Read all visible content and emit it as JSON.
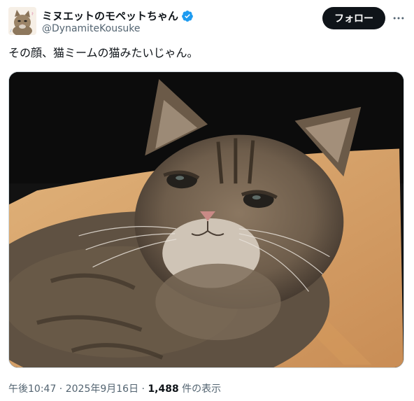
{
  "author": {
    "display_name": "ミヌエットのモペットちゃん",
    "handle": "@DynamiteKousuke",
    "verified": true,
    "avatar": "cat-avatar"
  },
  "actions": {
    "follow_label": "フォロー",
    "more_icon": "more-horizontal-icon"
  },
  "tweet": {
    "text": "その顔、猫ミームの猫みたいじゃん。",
    "media_description": "cat-photo"
  },
  "meta": {
    "time": "午後10:47",
    "separator": " · ",
    "date": "2025年9月16日",
    "views_count": "1,488",
    "views_label": " 件の表示"
  },
  "colors": {
    "verified_blue": "#1d9bf0",
    "primary_text": "#0f1419",
    "secondary_text": "#536471"
  }
}
